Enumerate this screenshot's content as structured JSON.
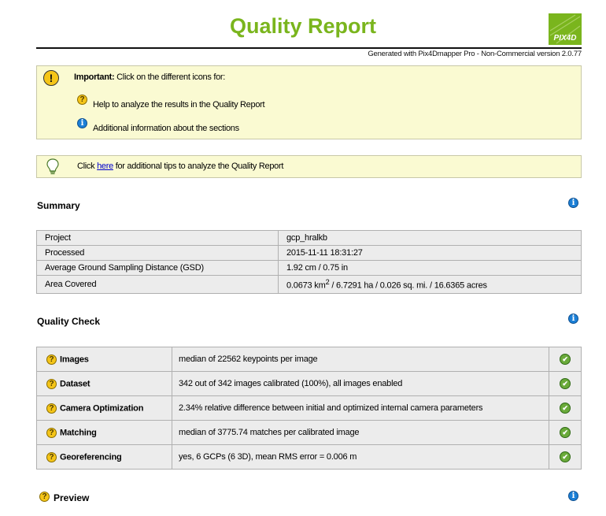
{
  "header": {
    "title": "Quality Report",
    "generated": "Generated with Pix4Dmapper Pro - Non-Commercial version 2.0.77",
    "logo_text": "PIX4D"
  },
  "important_box": {
    "heading": "Important:",
    "text": "Click on the different icons for:",
    "item_help": "Help to analyze the results in the Quality Report",
    "item_info": "Additional information about the sections"
  },
  "tip_box": {
    "prefix": "Click",
    "link": "here",
    "suffix": "for additional tips to analyze the Quality Report"
  },
  "summary": {
    "title": "Summary",
    "rows": [
      {
        "label": "Project",
        "value": "gcp_hralkb"
      },
      {
        "label": "Processed",
        "value": "2015-11-11 18:31:27"
      },
      {
        "label": "Average Ground Sampling Distance (GSD)",
        "value": "1.92 cm / 0.75 in"
      },
      {
        "label": "Area Covered",
        "value_pre": "0.0673 km",
        "value_sup": "2",
        "value_post": " / 6.7291 ha / 0.026 sq. mi. / 16.6365 acres"
      }
    ]
  },
  "quality_check": {
    "title": "Quality Check",
    "rows": [
      {
        "name": "Images",
        "value": "median of 22562 keypoints per image"
      },
      {
        "name": "Dataset",
        "value": "342 out of 342 images calibrated (100%), all images enabled"
      },
      {
        "name": "Camera Optimization",
        "value": "2.34% relative difference between initial and optimized internal camera parameters"
      },
      {
        "name": "Matching",
        "value": "median of 3775.74 matches per calibrated image"
      },
      {
        "name": "Georeferencing",
        "value": "yes, 6 GCPs (6 3D), mean RMS error = 0.006 m"
      }
    ]
  },
  "preview": {
    "title": "Preview"
  },
  "icons": {
    "help_glyph": "?",
    "info_glyph": "i",
    "important_glyph": "!",
    "ok_glyph": "✔"
  },
  "colors": {
    "title_green": "#7ab51d",
    "note_bg": "#fafad2",
    "table_bg": "#ececec",
    "help_yellow": "#f5c518",
    "info_blue": "#1b7fd6",
    "ok_green": "#6aaa3a"
  }
}
